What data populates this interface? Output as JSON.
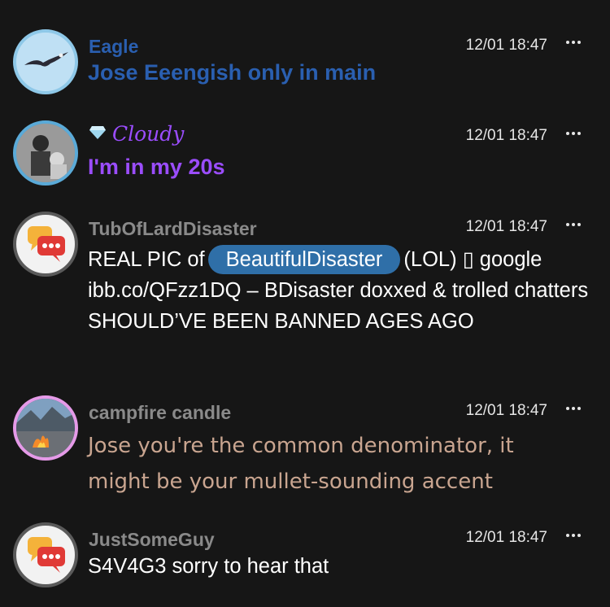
{
  "messages": [
    {
      "username": "Eagle",
      "timestamp": "12/01 18:47",
      "text": "Jose Eeengish only in main",
      "name_color": "#2a5fb0",
      "text_color": "#2a5fb0",
      "avatar_icon": "eagle-avatar-icon"
    },
    {
      "username": "Cloudy",
      "timestamp": "12/01 18:47",
      "text": "I'm in my 20s",
      "name_color": "#9b4dff",
      "text_color": "#9b4dff",
      "badge_icon": "diamond-icon",
      "avatar_icon": "photo-avatar-icon"
    },
    {
      "username": "TubOfLardDisaster",
      "timestamp": "12/01 18:47",
      "text_parts": {
        "before": "REAL PIC of",
        "mention": "BeautifulDisaster",
        "after": "(LOL) ▯ google ibb.co/QFzz1DQ – BDisaster doxxed & trolled chatters SHOULD’VE BEEN BANNED AGES AGO"
      },
      "name_color": "#8a8a8a",
      "text_color": "#ffffff",
      "mention_color": "#2f6fa8",
      "avatar_icon": "chat-bubbles-avatar-icon"
    },
    {
      "username": "campfire candle",
      "timestamp": "12/01 18:47",
      "text": "Jose you're the common denominator, it might be your mullet-sounding accent",
      "name_color": "#8a8a8a",
      "text_color": "#c9a590",
      "avatar_icon": "campfire-avatar-icon"
    },
    {
      "username": "JustSomeGuy",
      "timestamp": "12/01 18:47",
      "text": "S4V4G3 sorry to hear that",
      "name_color": "#8a8a8a",
      "text_color": "#ffffff",
      "avatar_icon": "chat-bubbles-avatar-icon"
    }
  ]
}
